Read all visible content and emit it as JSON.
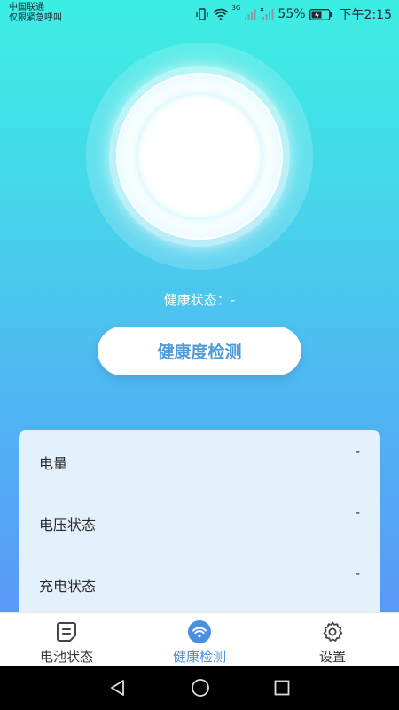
{
  "status_bar": {
    "carrier_line1": "中国联通",
    "carrier_line2": "仅限紧急呼叫",
    "network_label": "3G",
    "battery_percent": "55%",
    "time": "下午2:15"
  },
  "main": {
    "health_status_text": "健康状态：-",
    "detect_button_label": "健康度检测"
  },
  "info_card": {
    "rows": [
      {
        "label": "电量",
        "value": "-"
      },
      {
        "label": "电压状态",
        "value": "-"
      },
      {
        "label": "充电状态",
        "value": "-"
      }
    ]
  },
  "bottom_nav": {
    "items": [
      {
        "label": "电池状态",
        "icon": "battery-note-icon"
      },
      {
        "label": "健康检测",
        "icon": "wifi-signal-icon",
        "active": true
      },
      {
        "label": "设置",
        "icon": "gear-icon"
      }
    ]
  },
  "colors": {
    "gradient_top": "#3ceee3",
    "gradient_bottom": "#5a98f8",
    "accent": "#4a8fe0",
    "button_text": "#4f9bd8",
    "card_bg": "#e3f1fc"
  }
}
